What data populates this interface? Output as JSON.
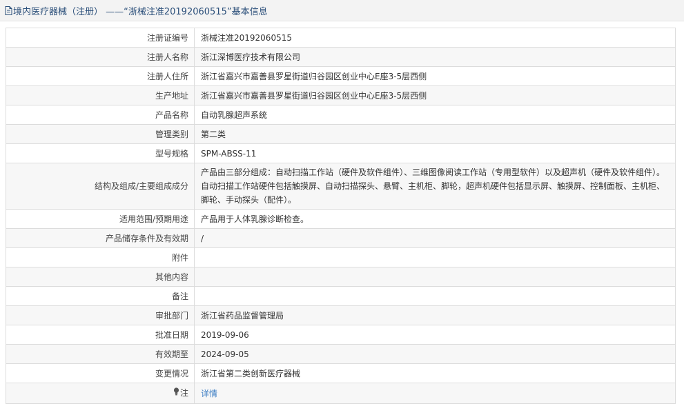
{
  "header": {
    "title": "境内医疗器械（注册） ——“浙械注准20192060515”基本信息"
  },
  "rows": [
    {
      "label": "注册证编号",
      "value": "浙械注准20192060515"
    },
    {
      "label": "注册人名称",
      "value": "浙江深博医疗技术有限公司"
    },
    {
      "label": "注册人住所",
      "value": "浙江省嘉兴市嘉善县罗星街道归谷园区创业中心E座3-5层西侧"
    },
    {
      "label": "生产地址",
      "value": "浙江省嘉兴市嘉善县罗星街道归谷园区创业中心E座3-5层西侧"
    },
    {
      "label": "产品名称",
      "value": "自动乳腺超声系统"
    },
    {
      "label": "管理类别",
      "value": "第二类"
    },
    {
      "label": "型号规格",
      "value": "SPM-ABSS-11"
    },
    {
      "label": "结构及组成/主要组成成分",
      "value": "产品由三部分组成：自动扫描工作站（硬件及软件组件）、三维图像阅读工作站（专用型软件）以及超声机（硬件及软件组件）。自动扫描工作站硬件包括触摸屏、自动扫描探头、悬臂、主机柜、脚轮，超声机硬件包括显示屏、触摸屏、控制面板、主机柜、脚轮、手动探头（配件）。"
    },
    {
      "label": "适用范围/预期用途",
      "value": "产品用于人体乳腺诊断检查。"
    },
    {
      "label": "产品储存条件及有效期",
      "value": "/"
    },
    {
      "label": "附件",
      "value": ""
    },
    {
      "label": "其他内容",
      "value": ""
    },
    {
      "label": "备注",
      "value": ""
    },
    {
      "label": "审批部门",
      "value": "浙江省药品监督管理局"
    },
    {
      "label": "批准日期",
      "value": "2019-09-06"
    },
    {
      "label": "有效期至",
      "value": "2024-09-05"
    },
    {
      "label": "变更情况",
      "value": "浙江省第二类创新医疗器械"
    }
  ],
  "note": {
    "label": "注",
    "icon": "lightbulb-icon",
    "link_text": "详情"
  },
  "colors": {
    "header_text": "#2b4f7a",
    "link": "#3f7fc4",
    "border": "#dcdcdc"
  }
}
